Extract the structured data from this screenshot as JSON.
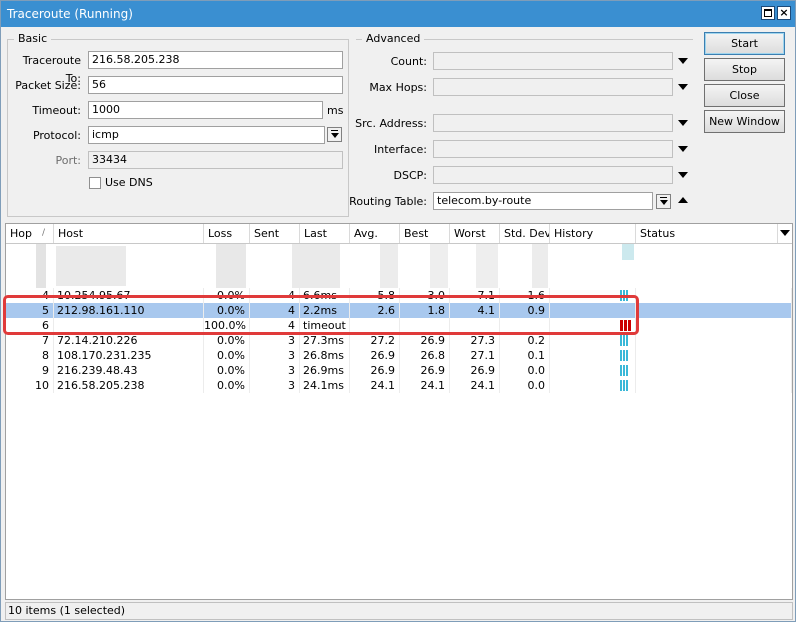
{
  "window": {
    "title": "Traceroute (Running)"
  },
  "basic": {
    "legend": "Basic",
    "traceroute_to": {
      "label": "Traceroute To:",
      "value": "216.58.205.238"
    },
    "packet_size": {
      "label": "Packet Size:",
      "value": "56"
    },
    "timeout": {
      "label": "Timeout:",
      "value": "1000",
      "unit": "ms"
    },
    "protocol": {
      "label": "Protocol:",
      "value": "icmp"
    },
    "port": {
      "label": "Port:",
      "value": "33434"
    },
    "use_dns": {
      "label": "Use DNS",
      "checked": false
    }
  },
  "advanced": {
    "legend": "Advanced",
    "count": {
      "label": "Count:",
      "value": ""
    },
    "max_hops": {
      "label": "Max Hops:",
      "value": ""
    },
    "src_address": {
      "label": "Src. Address:",
      "value": ""
    },
    "interface": {
      "label": "Interface:",
      "value": ""
    },
    "dscp": {
      "label": "DSCP:",
      "value": ""
    },
    "routing_table": {
      "label": "Routing Table:",
      "value": "telecom.by-route"
    }
  },
  "buttons": {
    "start": "Start",
    "stop": "Stop",
    "close": "Close",
    "new_window": "New Window"
  },
  "table": {
    "columns": [
      "Hop",
      "Host",
      "Loss",
      "Sent",
      "Last",
      "Avg.",
      "Best",
      "Worst",
      "Std. Dev.",
      "History",
      "Status"
    ],
    "rows": [
      {
        "hop": "4",
        "host": "10.254.95.67",
        "loss": "0.0%",
        "sent": "4",
        "last": "6.6ms",
        "avg": "5.8",
        "best": "3.0",
        "worst": "7.1",
        "stdev": "1.6",
        "history": "cyan",
        "selected": false
      },
      {
        "hop": "5",
        "host": "212.98.161.110",
        "loss": "0.0%",
        "sent": "4",
        "last": "2.2ms",
        "avg": "2.6",
        "best": "1.8",
        "worst": "4.1",
        "stdev": "0.9",
        "history": "none",
        "selected": true
      },
      {
        "hop": "6",
        "host": "",
        "loss": "100.0%",
        "sent": "4",
        "last": "timeout",
        "avg": "",
        "best": "",
        "worst": "",
        "stdev": "",
        "history": "red",
        "selected": false
      },
      {
        "hop": "7",
        "host": "72.14.210.226",
        "loss": "0.0%",
        "sent": "3",
        "last": "27.3ms",
        "avg": "27.2",
        "best": "26.9",
        "worst": "27.3",
        "stdev": "0.2",
        "history": "cyan",
        "selected": false
      },
      {
        "hop": "8",
        "host": "108.170.231.235",
        "loss": "0.0%",
        "sent": "3",
        "last": "26.8ms",
        "avg": "26.9",
        "best": "26.8",
        "worst": "27.1",
        "stdev": "0.1",
        "history": "cyan",
        "selected": false
      },
      {
        "hop": "9",
        "host": "216.239.48.43",
        "loss": "0.0%",
        "sent": "3",
        "last": "26.9ms",
        "avg": "26.9",
        "best": "26.9",
        "worst": "26.9",
        "stdev": "0.0",
        "history": "cyan",
        "selected": false
      },
      {
        "hop": "10",
        "host": "216.58.205.238",
        "loss": "0.0%",
        "sent": "3",
        "last": "24.1ms",
        "avg": "24.1",
        "best": "24.1",
        "worst": "24.1",
        "stdev": "0.0",
        "history": "cyan",
        "selected": false
      }
    ]
  },
  "colors": {
    "history_ok": "#3ab8d8",
    "history_fail": "#cc0000",
    "selection": "#a8c8ee",
    "highlight": "#e03a3a"
  },
  "statusbar": {
    "text": "10 items (1 selected)"
  }
}
